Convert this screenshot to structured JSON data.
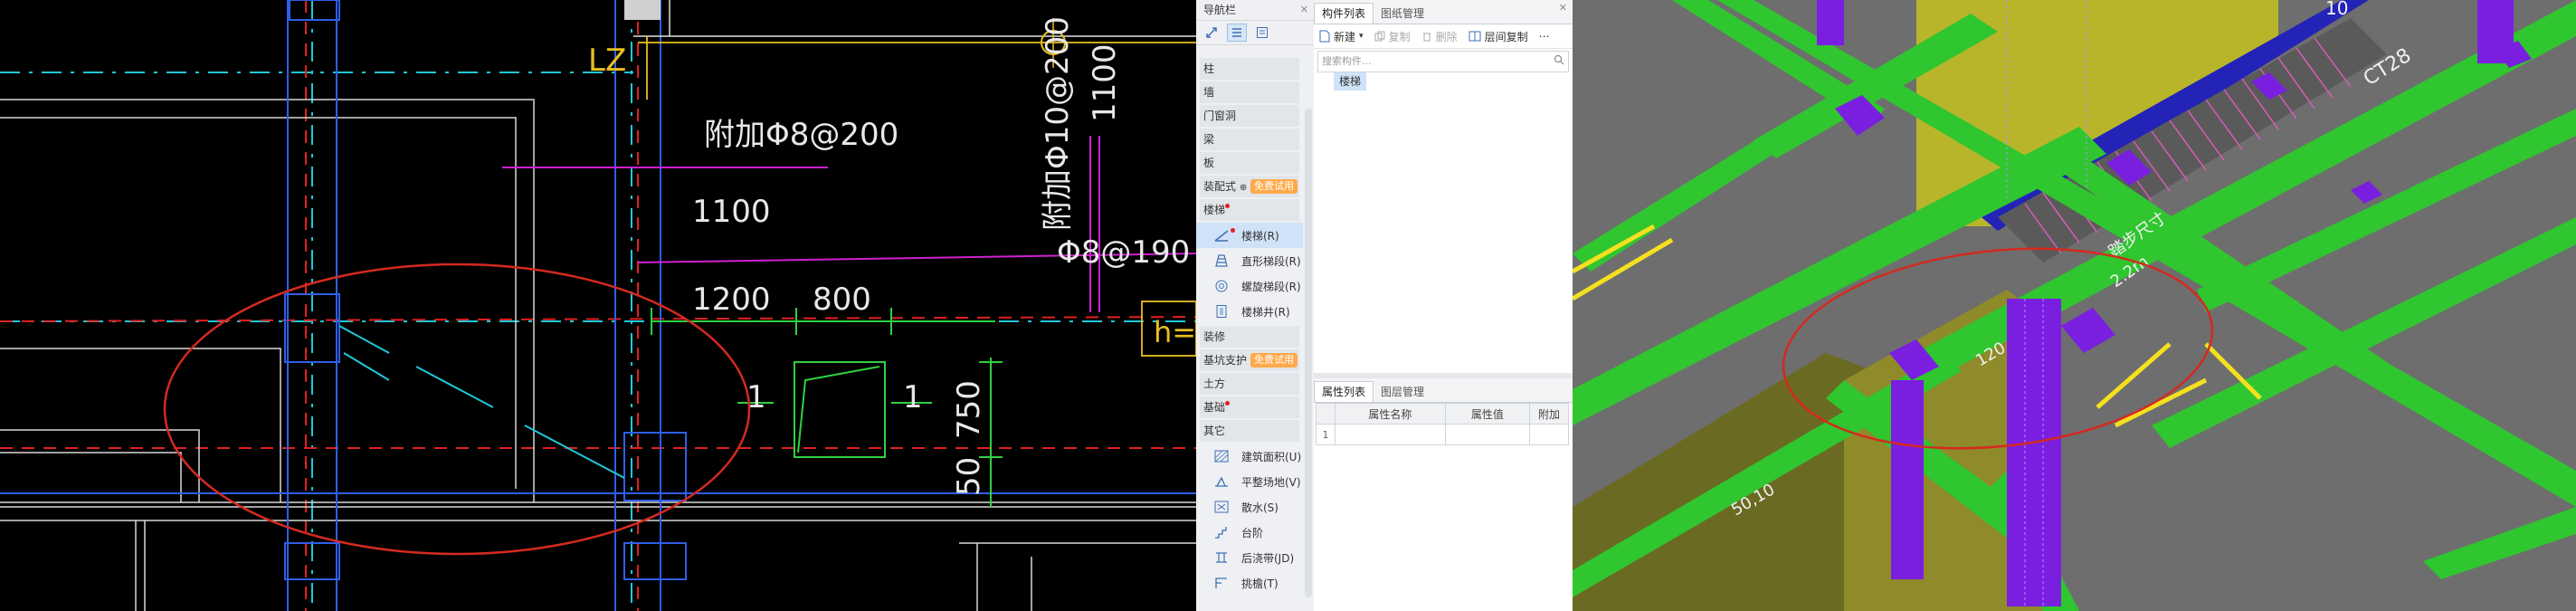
{
  "cad": {
    "labels": {
      "lz": "LZ",
      "rebar1": "附加Φ8@200",
      "rebar2": "附加Φ10@200",
      "dim1100a": "1100",
      "dim1100b": "1100",
      "rebar3": "Φ8@190",
      "dim1200": "1200",
      "dim800": "800",
      "dim750": "750",
      "dim50": "50",
      "one_a": "1",
      "one_b": "1",
      "h_label": "h="
    }
  },
  "nav": {
    "title": "导航栏",
    "categories": {
      "zhu": "柱",
      "qiang": "墙",
      "menchuangdong": "门窗洞",
      "liang": "梁",
      "ban": "板",
      "zhuangpei": "装配式",
      "louti": "楼梯",
      "zhuangxiu": "装修",
      "jikeng": "基坑支护",
      "tufang": "土方",
      "jichu": "基础",
      "qita": "其它"
    },
    "badges": {
      "trial1": "免费试用",
      "trial2": "免费试用"
    },
    "stair_items": [
      "楼梯(R)",
      "直形梯段(R)",
      "螺旋梯段(R)",
      "楼梯井(R)"
    ],
    "other_items": [
      "建筑面积(U)",
      "平整场地(V)",
      "散水(S)",
      "台阶",
      "后浇带(JD)",
      "挑檐(T)"
    ]
  },
  "components": {
    "tabs": [
      "构件列表",
      "图纸管理"
    ],
    "toolbar": {
      "new": "新建",
      "copy": "复制",
      "delete": "删除",
      "floor_copy": "层间复制"
    },
    "search_placeholder": "搜索构件...",
    "tree_item": "楼梯"
  },
  "properties": {
    "tabs": [
      "属性列表",
      "图层管理"
    ],
    "headers": [
      "属性名称",
      "属性值",
      "附加"
    ],
    "row_no": "1"
  },
  "view3d": {
    "labels": {
      "num10": "10",
      "stair_label": "CT28",
      "tag1": "踏步尺寸",
      "tag2": "2.2m",
      "dim_left": "50,10",
      "dim_mid": "120"
    }
  },
  "colors": {
    "cad_bg": "#000000",
    "annotation_circle": "#d42a20",
    "beam_green": "#2fc62f",
    "column_purple": "#7a1fe0",
    "slab_olive": "#8f8a2a"
  }
}
